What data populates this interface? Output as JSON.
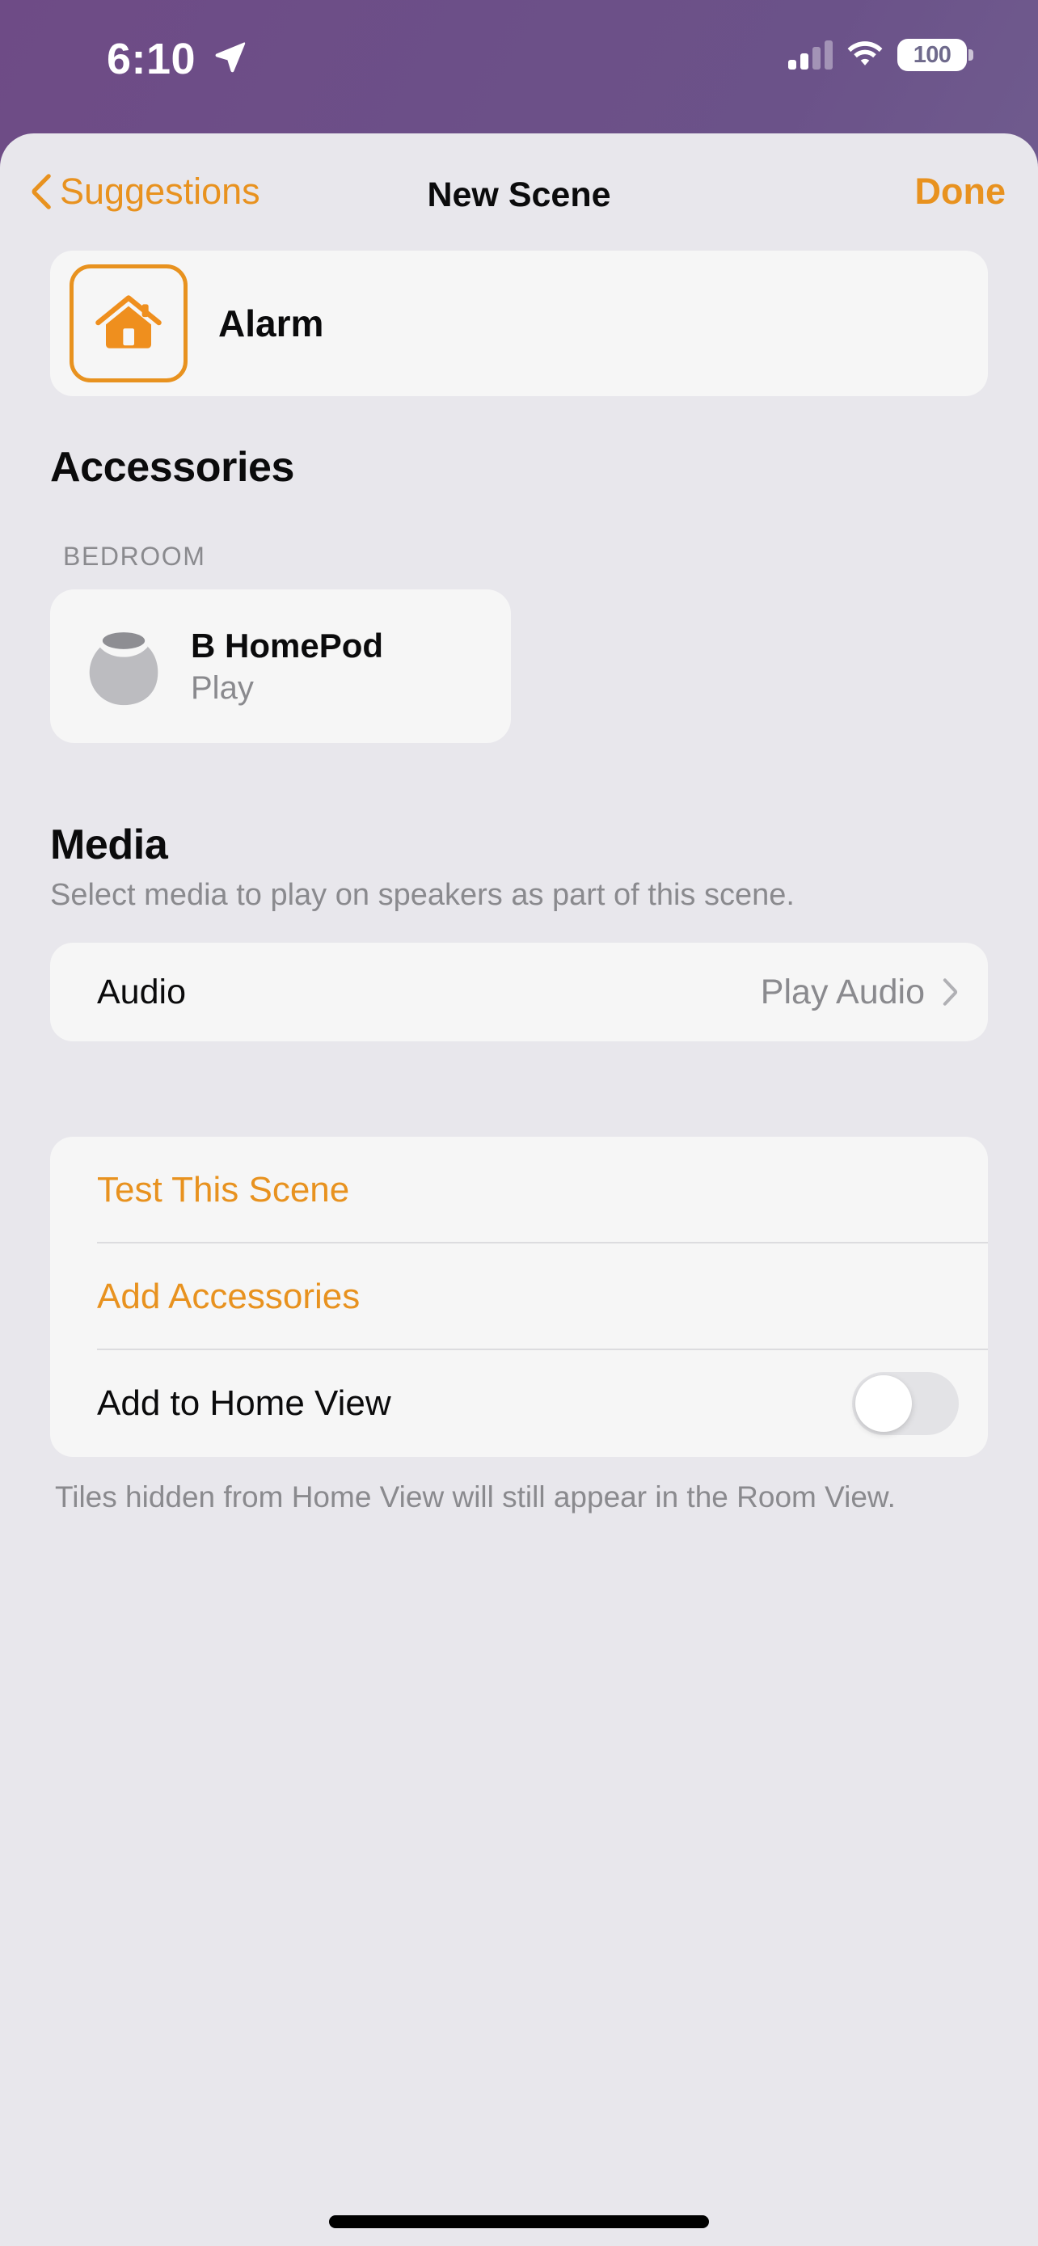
{
  "status_bar": {
    "time": "6:10",
    "location_icon": "location-arrow-icon",
    "cellular_icon": "cellular-signal-icon",
    "cellular_bars_filled": 2,
    "cellular_bars_total": 4,
    "wifi_icon": "wifi-icon",
    "battery_percent": "100",
    "battery_icon": "battery-full-icon"
  },
  "nav": {
    "back_label": "Suggestions",
    "back_icon": "chevron-left-icon",
    "title": "New Scene",
    "done_label": "Done"
  },
  "scene": {
    "icon": "house-icon",
    "name": "Alarm"
  },
  "accessories": {
    "heading": "Accessories",
    "room_label": "BEDROOM",
    "items": [
      {
        "icon": "homepod-icon",
        "name": "B HomePod",
        "state": "Play"
      }
    ]
  },
  "media": {
    "heading": "Media",
    "subtitle": "Select media to play on speakers as part of this scene.",
    "rows": [
      {
        "label": "Audio",
        "value": "Play Audio",
        "accessory_icon": "chevron-right-icon"
      }
    ]
  },
  "actions": {
    "test_scene_label": "Test This Scene",
    "add_accessories_label": "Add Accessories",
    "add_to_home_view_label": "Add to Home View",
    "add_to_home_view_state": "off",
    "footnote": "Tiles hidden from Home View will still appear in the Room View."
  },
  "colors": {
    "accent_orange": "#e8921f",
    "page_background": "#e8e7ec",
    "card_background": "#f6f6f6",
    "secondary_text": "#8a8a8e",
    "primary_text": "#0b0b0c"
  },
  "home_indicator": "home-indicator"
}
